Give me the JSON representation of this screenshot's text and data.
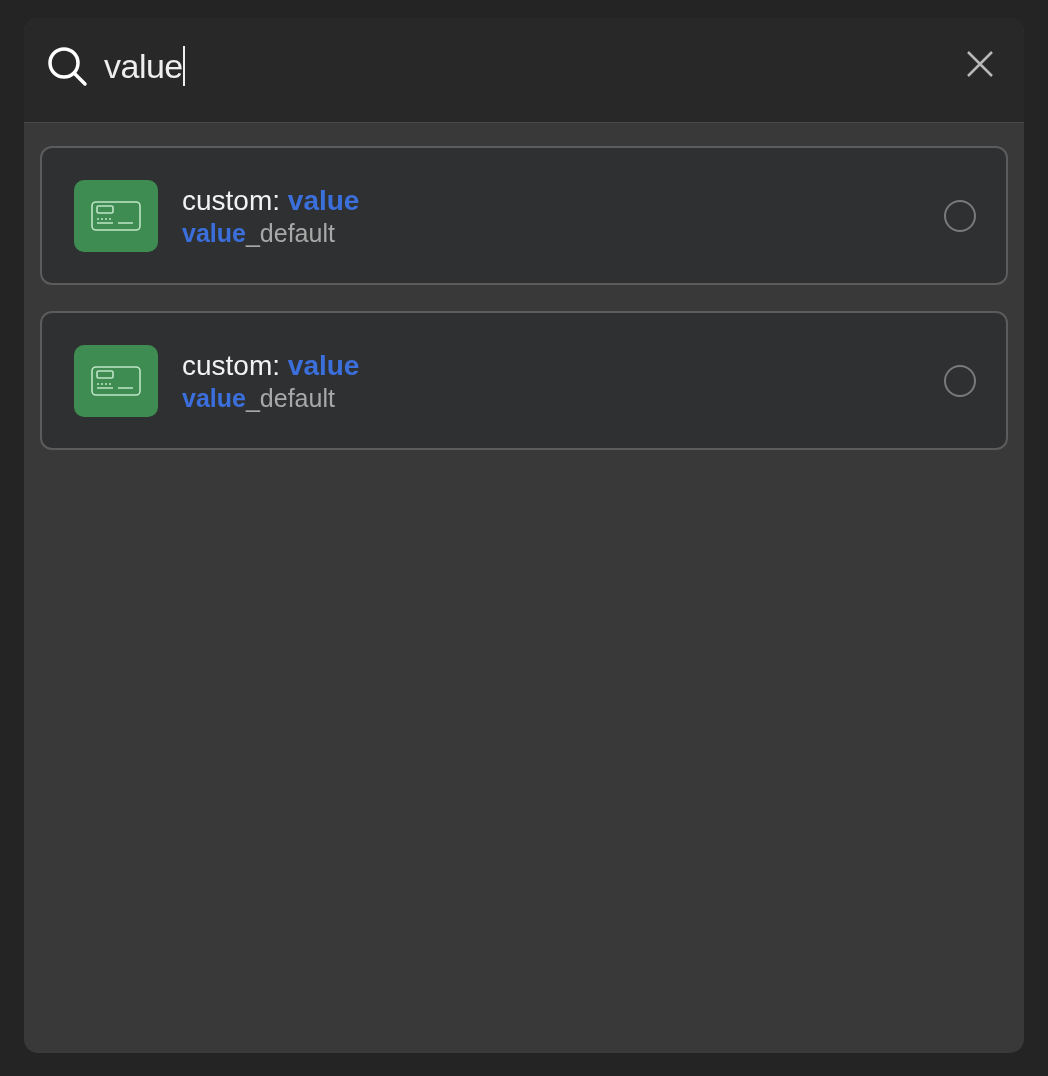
{
  "search": {
    "value": "value"
  },
  "results": [
    {
      "title": "custom: **value**",
      "subtitle": "**value**_default",
      "selected": false
    },
    {
      "title": "custom: **value**",
      "subtitle": "**value**_default",
      "selected": false
    }
  ]
}
